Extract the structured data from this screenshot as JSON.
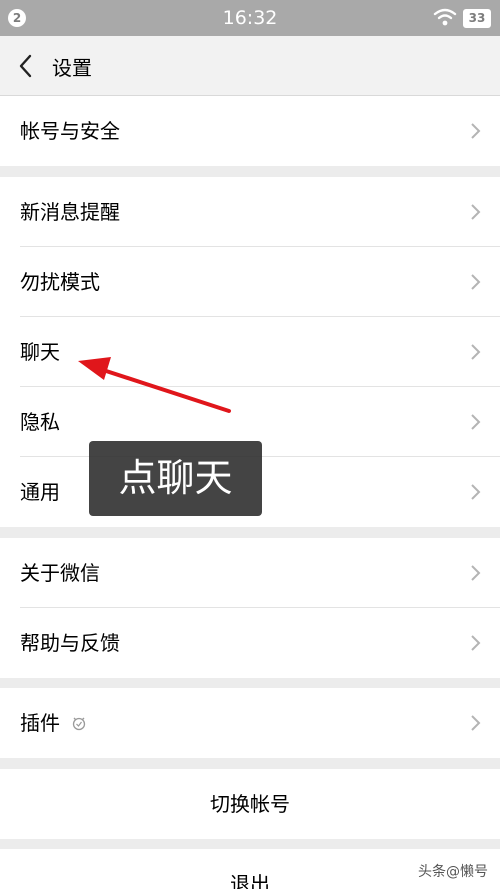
{
  "status_bar": {
    "notification_count": "2",
    "time": "16:32",
    "battery": "33"
  },
  "nav": {
    "title": "设置"
  },
  "settings": {
    "account_security": "帐号与安全",
    "new_message_alerts": "新消息提醒",
    "do_not_disturb": "勿扰模式",
    "chat": "聊天",
    "privacy": "隐私",
    "general": "通用",
    "about_wechat": "关于微信",
    "help_feedback": "帮助与反馈",
    "plugins": "插件",
    "switch_account": "切换帐号",
    "logout": "退出"
  },
  "annotation": {
    "overlay_text": "点聊天",
    "arrow_color": "#e0161b"
  },
  "watermark": "头条@懒号"
}
